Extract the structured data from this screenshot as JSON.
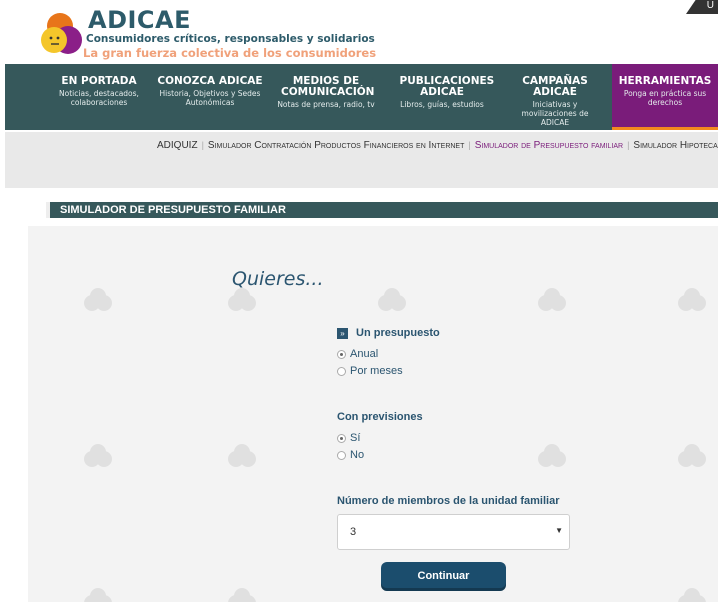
{
  "header": {
    "brand": "ADICAE",
    "tagline": "Consumidores críticos, responsables y solidarios",
    "slogan": "La gran fuerza colectiva de los consumidores",
    "corner": "U"
  },
  "nav": [
    {
      "title": "EN PORTADA",
      "sub": "Noticias, destacados, colaboraciones"
    },
    {
      "title": "CONOZCA ADICAE",
      "sub": "Historia, Objetivos y Sedes Autonómicas"
    },
    {
      "title": "MEDIOS DE COMUNICACIÓN",
      "sub": "Notas de prensa, radio, tv"
    },
    {
      "title": "PUBLICACIONES ADICAE",
      "sub": "Libros, guías, estudios"
    },
    {
      "title": "CAMPAÑAS ADICAE",
      "sub": "Iniciativas y movilizaciones de ADICAE"
    },
    {
      "title": "HERRAMIENTAS",
      "sub": "Ponga en práctica sus derechos"
    }
  ],
  "subnav": [
    "ADIQUIZ",
    "Simulador Contratación Productos Financieros en Internet",
    "Simulador de Presupuesto familiar",
    "Simulador Hipotecario"
  ],
  "section_title": "SIMULADOR DE PRESUPUESTO FAMILIAR",
  "form": {
    "heading": "Quieres...",
    "q1": {
      "label": "Un presupuesto",
      "options": [
        "Anual",
        "Por meses"
      ],
      "selected": "Anual"
    },
    "q2": {
      "label": "Con previsiones",
      "options": [
        "Sí",
        "No"
      ],
      "selected": "Sí"
    },
    "q3": {
      "label": "Número de miembros de la unidad familiar",
      "value": "3"
    },
    "submit": "Continuar"
  },
  "colors": {
    "nav_bg": "#36585b",
    "active_tab": "#7a1c7a",
    "accent": "#f28a1f",
    "primary": "#1b4d6d"
  }
}
